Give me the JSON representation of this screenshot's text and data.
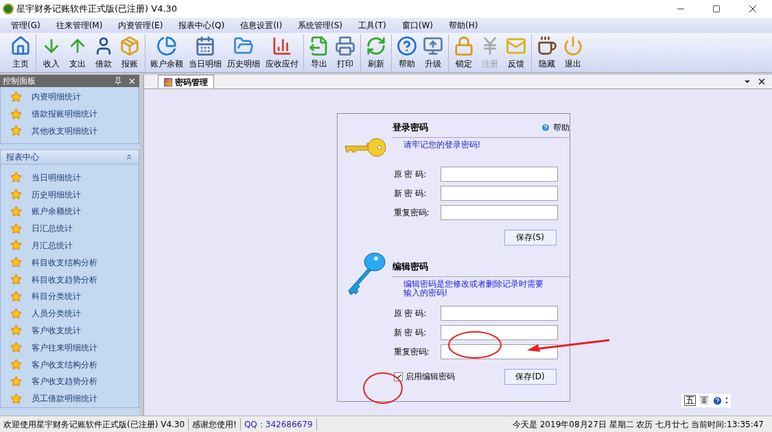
{
  "window": {
    "title": "星宇财务记账软件正式版(已注册) V4.30"
  },
  "menu": [
    "管理(G)",
    "往来管理(M)",
    "内资管理(E)",
    "报表中心(Q)",
    "信息设置(I)",
    "系统管理(S)",
    "工具(T)",
    "窗口(W)",
    "帮助(H)"
  ],
  "toolbar": [
    [
      {
        "label": "主页",
        "kind": "home",
        "disabled": false
      }
    ],
    [
      {
        "label": "收入",
        "kind": "income",
        "disabled": false
      },
      {
        "label": "支出",
        "kind": "expense",
        "disabled": false
      },
      {
        "label": "借款",
        "kind": "person",
        "disabled": false
      },
      {
        "label": "报账",
        "kind": "box",
        "disabled": false
      }
    ],
    [
      {
        "label": "账户余额",
        "kind": "pie",
        "disabled": false
      },
      {
        "label": "当日明细",
        "kind": "calendar",
        "disabled": false
      },
      {
        "label": "历史明细",
        "kind": "folder",
        "disabled": false
      },
      {
        "label": "应收应付",
        "kind": "chart",
        "disabled": false
      }
    ],
    [
      {
        "label": "导出",
        "kind": "export",
        "disabled": false
      },
      {
        "label": "打印",
        "kind": "print",
        "disabled": false
      }
    ],
    [
      {
        "label": "刷新",
        "kind": "refresh",
        "disabled": false
      }
    ],
    [
      {
        "label": "帮助",
        "kind": "help",
        "disabled": false
      },
      {
        "label": "升级",
        "kind": "upgrade",
        "disabled": false
      }
    ],
    [
      {
        "label": "锁定",
        "kind": "lock",
        "disabled": false
      },
      {
        "label": "注册",
        "kind": "yen",
        "disabled": true
      },
      {
        "label": "反馈",
        "kind": "mail",
        "disabled": false
      }
    ],
    [
      {
        "label": "隐藏",
        "kind": "coffee",
        "disabled": false
      },
      {
        "label": "退出",
        "kind": "power",
        "disabled": false
      }
    ]
  ],
  "sidebar": {
    "title": "控制面板",
    "sections": [
      {
        "items": [
          "内资明细统计",
          "借款报账明细统计",
          "其他收支明细统计"
        ]
      },
      {
        "title": "报表中心",
        "expanded": true,
        "items": [
          "当日明细统计",
          "历史明细统计",
          "账户余额统计",
          "日汇总统计",
          "月汇总统计",
          "科目收支结构分析",
          "科目收支趋势分析",
          "科目分类统计",
          "人员分类统计",
          "客户收支统计",
          "客户往来明细统计",
          "客户收支结构分析",
          "客户收支趋势分析",
          "员工借款明细统计"
        ]
      }
    ]
  },
  "tabs": [
    {
      "label": "密码管理",
      "selected": true
    }
  ],
  "form": {
    "sections": [
      {
        "title": "登录密码",
        "help": "帮助",
        "note": "请牢记您的登录密码!",
        "kind": "gold",
        "fields": [
          {
            "label": "原 密 码:"
          },
          {
            "label": "新 密 码:"
          },
          {
            "label": "重复密码:"
          }
        ],
        "save": "保存(S)"
      },
      {
        "title": "编辑密码",
        "note": "编辑密码是您修改或者删除记录时需要输入的密码!",
        "kind": "blue",
        "fields": [
          {
            "label": "原 密 码:"
          },
          {
            "label": "新 密 码:"
          },
          {
            "label": "重复密码:"
          }
        ],
        "checkbox": {
          "label": "启用编辑密码",
          "checked": true
        },
        "save": "保存(D)"
      }
    ]
  },
  "ime": {
    "mode": "五"
  },
  "status_bar": [
    "欢迎使用星宇财务记账软件正式版(已注册) V4.30",
    "感谢您使用!",
    "QQ：342686679",
    "今天是 2019年08月27日 星期二 农历 七月廿七 当前时间:13:35:47"
  ]
}
